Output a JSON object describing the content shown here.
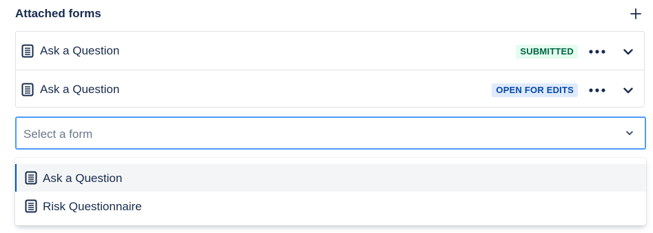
{
  "header": {
    "title": "Attached forms",
    "add_icon": "plus-icon"
  },
  "attached_forms": [
    {
      "name": "Ask a Question",
      "status": "SUBMITTED",
      "status_color": "#006644",
      "status_bg": "#e3fcef",
      "icon": "form-document-icon"
    },
    {
      "name": "Ask a Question",
      "status": "OPEN FOR EDITS",
      "status_color": "#0747a6",
      "status_bg": "#deebff",
      "icon": "form-document-icon"
    }
  ],
  "select": {
    "placeholder": "Select a form",
    "focus_color": "#4c9aff"
  },
  "dropdown": {
    "options": [
      {
        "label": "Ask a Question",
        "highlighted": true,
        "icon": "form-document-icon"
      },
      {
        "label": "Risk Questionnaire",
        "highlighted": false,
        "icon": "form-document-icon"
      }
    ]
  },
  "colors": {
    "text": "#172b4d",
    "border": "#dfe1e6",
    "accent": "#0052cc"
  }
}
